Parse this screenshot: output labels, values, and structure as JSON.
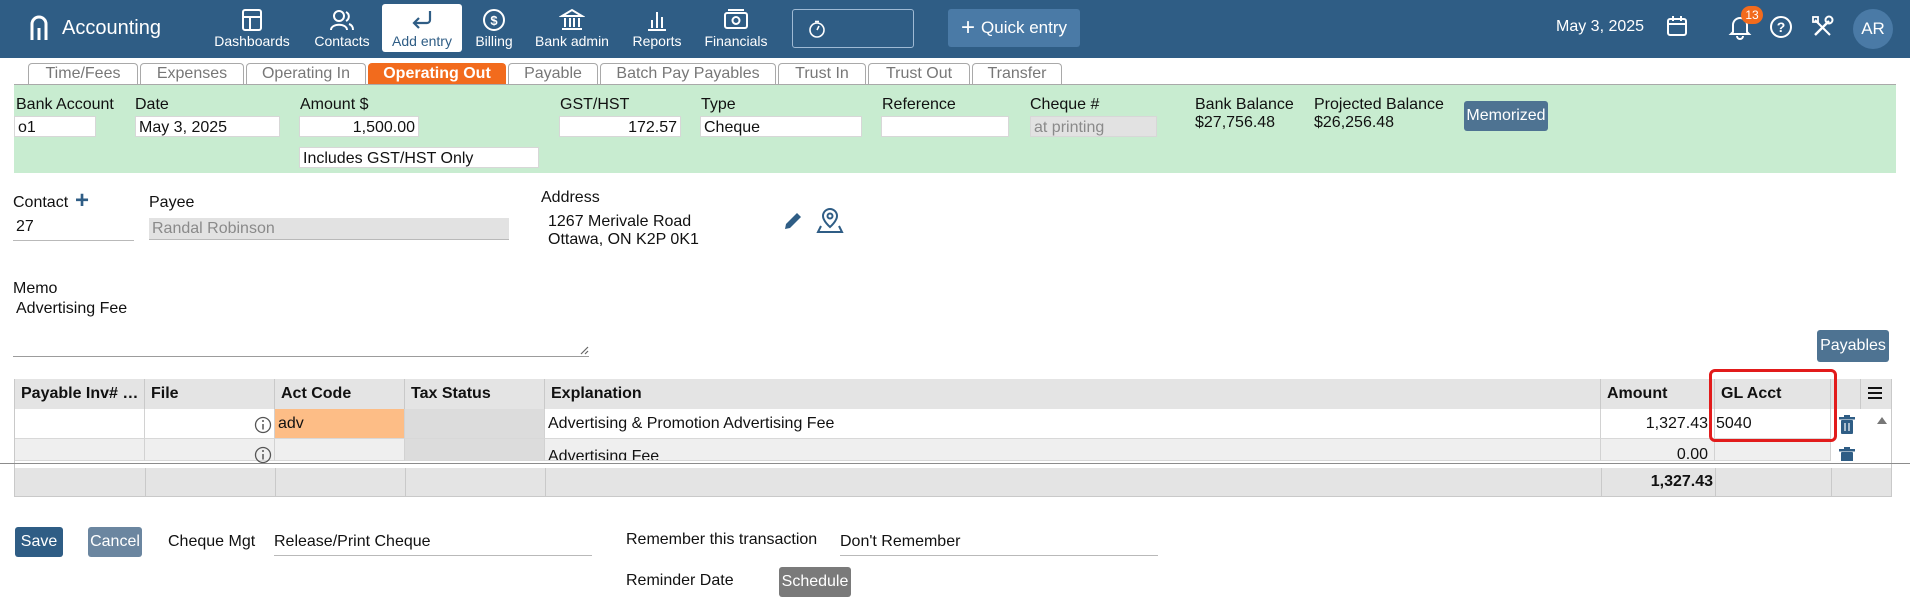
{
  "app": {
    "name": "Accounting"
  },
  "nav": [
    {
      "label": "Dashboards",
      "icon": "dashboard-icon"
    },
    {
      "label": "Contacts",
      "icon": "contacts-icon"
    },
    {
      "label": "Add entry",
      "icon": "add-entry-icon",
      "active": true
    },
    {
      "label": "Billing",
      "icon": "billing-icon"
    },
    {
      "label": "Bank admin",
      "icon": "bank-icon"
    },
    {
      "label": "Reports",
      "icon": "reports-icon"
    },
    {
      "label": "Financials",
      "icon": "financials-icon"
    }
  ],
  "quick_entry": "Quick entry",
  "top_date": "May 3, 2025",
  "notifications_count": "13",
  "avatar_initials": "AR",
  "tabs": [
    "Time/Fees",
    "Expenses",
    "Operating In",
    "Operating Out",
    "Payable",
    "Batch Pay Payables",
    "Trust In",
    "Trust Out",
    "Transfer"
  ],
  "active_tab": "Operating Out",
  "form": {
    "bank_account_label": "Bank Account",
    "bank_account": "o1",
    "date_label": "Date",
    "date": "May 3, 2025",
    "amount_label": "Amount $",
    "amount": "1,500.00",
    "gst_mode": "Includes GST/HST Only",
    "gst_label": "GST/HST",
    "gst": "172.57",
    "type_label": "Type",
    "type": "Cheque",
    "reference_label": "Reference",
    "reference": "",
    "cheque_label": "Cheque #",
    "cheque_placeholder": "at printing",
    "bank_balance_label": "Bank Balance",
    "bank_balance": "$27,756.48",
    "projected_balance_label": "Projected Balance",
    "projected_balance": "$26,256.48",
    "memorized_label": "Memorized"
  },
  "contact": {
    "contact_label": "Contact",
    "contact_value": "27",
    "payee_label": "Payee",
    "payee_value": "Randal Robinson",
    "address_label": "Address",
    "address_line1": "1267 Merivale Road",
    "address_line2": "Ottawa, ON K2P 0K1"
  },
  "memo": {
    "label": "Memo",
    "value": "Advertising Fee"
  },
  "payables_button": "Payables",
  "table": {
    "headers": [
      "Payable Inv# …",
      "File",
      "Act Code",
      "Tax Status",
      "Explanation",
      "Amount",
      "GL Acct"
    ],
    "rows": [
      {
        "act_code": "adv",
        "explanation": "Advertising & Promotion Advertising Fee",
        "amount": "1,327.43",
        "gl_acct": "5040"
      },
      {
        "act_code": "",
        "explanation": "Advertising Fee",
        "amount": "0.00",
        "gl_acct": ""
      }
    ],
    "total": "1,327.43"
  },
  "bottom": {
    "save": "Save",
    "cancel": "Cancel",
    "cheque_mgt_label": "Cheque Mgt",
    "cheque_mgt_value": "Release/Print Cheque",
    "remember_label": "Remember this transaction",
    "remember_value": "Don't Remember",
    "reminder_label": "Reminder Date",
    "schedule": "Schedule"
  },
  "colors": {
    "topbar": "#2f5d85",
    "active_tab": "#f26b1d",
    "panel": "#c8ecd0",
    "act_code_highlight": "#fdbd86",
    "highlight_border": "#e21b1b"
  }
}
